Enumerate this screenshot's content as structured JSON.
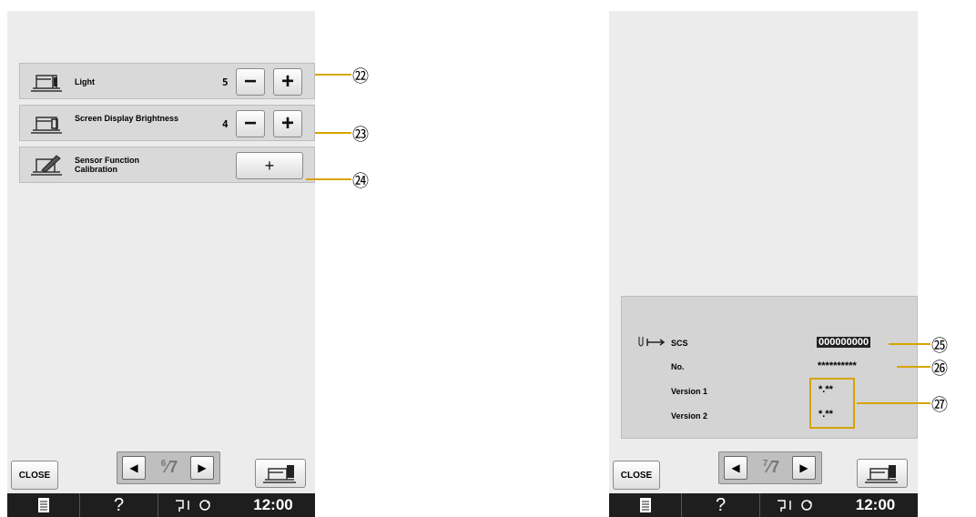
{
  "left_screen": {
    "settings": [
      {
        "label": "Light",
        "value": "5",
        "icon": "sewing-machine-light-icon",
        "minus": "−",
        "plus": "+"
      },
      {
        "label": "Screen Display Brightness",
        "value": "4",
        "icon": "sewing-machine-screen-icon",
        "minus": "−",
        "plus": "+"
      },
      {
        "label": "Sensor Function Calibration",
        "icon": "sensor-pen-icon",
        "button": "+"
      }
    ],
    "close_label": "CLOSE",
    "page_current": "6",
    "page_total": "7"
  },
  "right_screen": {
    "info": {
      "scs_label": "SCS",
      "scs_value": "000000000",
      "no_label": "No.",
      "no_value": "**********",
      "version1_label": "Version 1",
      "version1_value": "*.**",
      "version2_label": "Version 2",
      "version2_value": "*.**"
    },
    "close_label": "CLOSE",
    "page_current": "7",
    "page_total": "7"
  },
  "status_bar": {
    "help": "?",
    "time": "12:00"
  },
  "callouts": [
    "㉒",
    "㉓",
    "㉔",
    "㉕",
    "㉖",
    "㉗"
  ],
  "colors": {
    "callout": "#d6a400",
    "status_bar": "#1e1e1e",
    "panel": "#ececec"
  }
}
